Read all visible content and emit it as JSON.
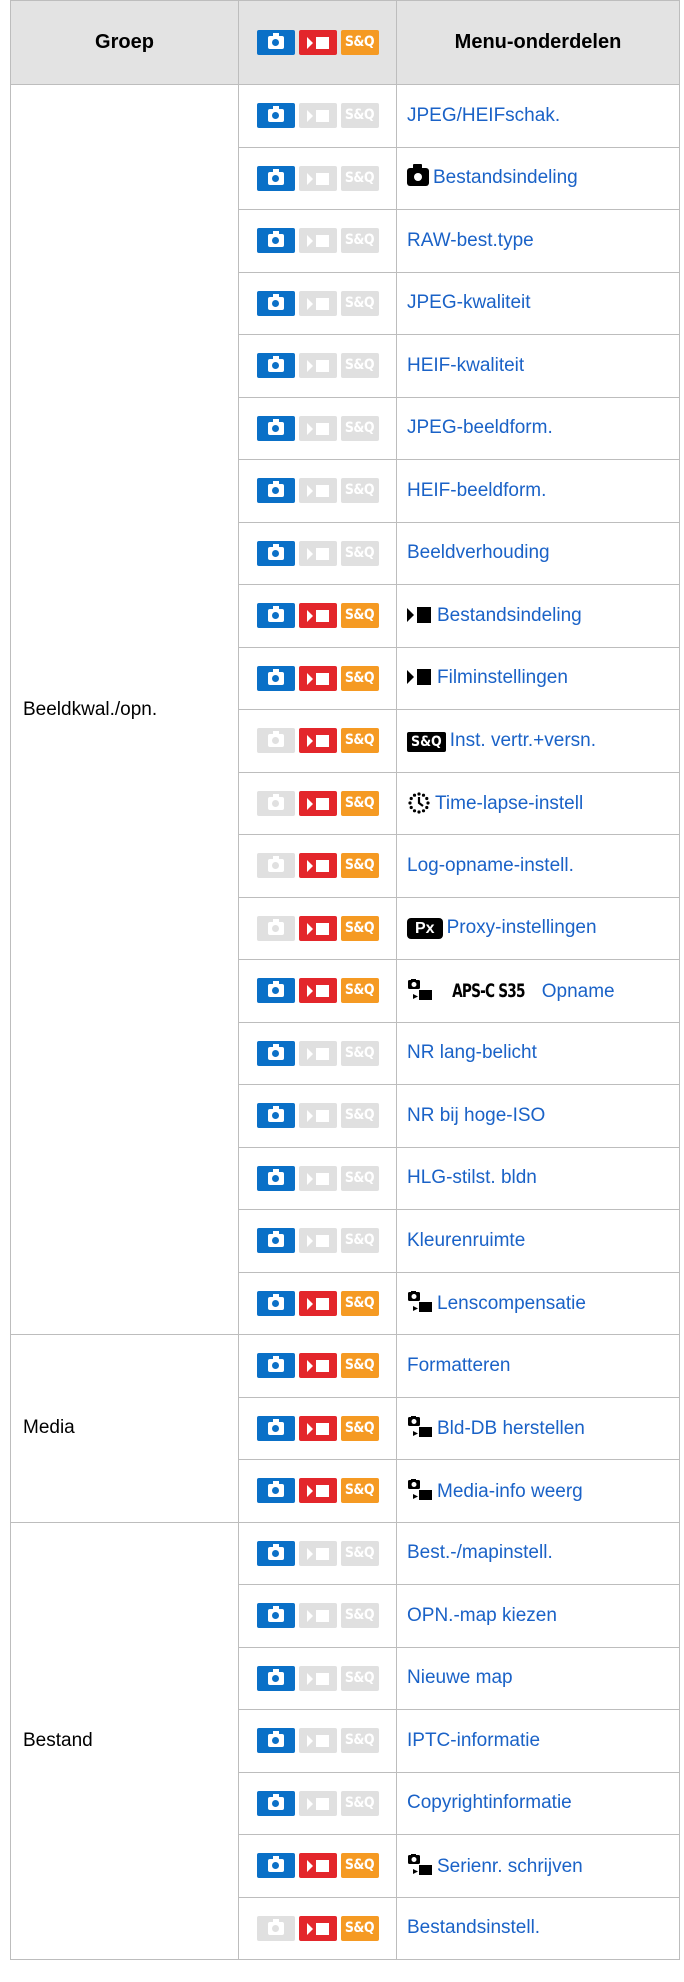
{
  "header": {
    "group": "Groep",
    "menu": "Menu-onderdelen"
  },
  "mode_icons": {
    "photo": "camera-photo-icon",
    "movie": "movie-icon",
    "sq": "S&Q",
    "colors": {
      "photo": "#0a70c7",
      "movie": "#e3262b",
      "sq": "#f59a23",
      "off": "#e0e0e0",
      "link": "#1a62c7"
    }
  },
  "header_modes": {
    "photo": true,
    "movie": true,
    "sq": true
  },
  "prefix_icons": {
    "aps_label": "APS-C S35",
    "px_label": "Px",
    "sq_label": "S&Q"
  },
  "groups": [
    {
      "name": "Beeldkwal./opn.",
      "rows": [
        {
          "label": "JPEG/HEIFschak.",
          "photo": true,
          "movie": false,
          "sq": false,
          "prefix": ""
        },
        {
          "label": "Bestandsindeling",
          "photo": true,
          "movie": false,
          "sq": false,
          "prefix": "camera"
        },
        {
          "label": "RAW-best.type",
          "photo": true,
          "movie": false,
          "sq": false,
          "prefix": ""
        },
        {
          "label": "JPEG-kwaliteit",
          "photo": true,
          "movie": false,
          "sq": false,
          "prefix": ""
        },
        {
          "label": "HEIF-kwaliteit",
          "photo": true,
          "movie": false,
          "sq": false,
          "prefix": ""
        },
        {
          "label": "JPEG-beeldform.",
          "photo": true,
          "movie": false,
          "sq": false,
          "prefix": ""
        },
        {
          "label": "HEIF-beeldform.",
          "photo": true,
          "movie": false,
          "sq": false,
          "prefix": ""
        },
        {
          "label": "Beeldverhouding",
          "photo": true,
          "movie": false,
          "sq": false,
          "prefix": ""
        },
        {
          "label": "Bestandsindeling",
          "photo": true,
          "movie": true,
          "sq": true,
          "prefix": "movie"
        },
        {
          "label": "Filminstellingen",
          "photo": true,
          "movie": true,
          "sq": true,
          "prefix": "movie"
        },
        {
          "label": "Inst. vertr.+versn.",
          "photo": false,
          "movie": true,
          "sq": true,
          "prefix": "sq"
        },
        {
          "label": "Time-lapse-instell",
          "photo": false,
          "movie": true,
          "sq": true,
          "prefix": "timelapse"
        },
        {
          "label": "Log-opname-instell.",
          "photo": false,
          "movie": true,
          "sq": true,
          "prefix": ""
        },
        {
          "label": "Proxy-instellingen",
          "photo": false,
          "movie": true,
          "sq": true,
          "prefix": "px"
        },
        {
          "label": "Opname",
          "photo": true,
          "movie": true,
          "sq": true,
          "prefix": "select-aps"
        },
        {
          "label": "NR lang-belicht",
          "photo": true,
          "movie": false,
          "sq": false,
          "prefix": ""
        },
        {
          "label": "NR bij hoge-ISO",
          "photo": true,
          "movie": false,
          "sq": false,
          "prefix": ""
        },
        {
          "label": "HLG-stilst. bldn",
          "photo": true,
          "movie": false,
          "sq": false,
          "prefix": ""
        },
        {
          "label": "Kleurenruimte",
          "photo": true,
          "movie": false,
          "sq": false,
          "prefix": ""
        },
        {
          "label": "Lenscompensatie",
          "photo": true,
          "movie": true,
          "sq": true,
          "prefix": "select"
        }
      ]
    },
    {
      "name": "Media",
      "rows": [
        {
          "label": "Formatteren",
          "photo": true,
          "movie": true,
          "sq": true,
          "prefix": ""
        },
        {
          "label": "Bld-DB herstellen",
          "photo": true,
          "movie": true,
          "sq": true,
          "prefix": "select"
        },
        {
          "label": "Media-info weerg",
          "photo": true,
          "movie": true,
          "sq": true,
          "prefix": "select"
        }
      ]
    },
    {
      "name": "Bestand",
      "rows": [
        {
          "label": "Best.-/mapinstell.",
          "photo": true,
          "movie": false,
          "sq": false,
          "prefix": ""
        },
        {
          "label": "OPN.-map kiezen",
          "photo": true,
          "movie": false,
          "sq": false,
          "prefix": ""
        },
        {
          "label": "Nieuwe map",
          "photo": true,
          "movie": false,
          "sq": false,
          "prefix": ""
        },
        {
          "label": "IPTC-informatie",
          "photo": true,
          "movie": false,
          "sq": false,
          "prefix": ""
        },
        {
          "label": "Copyrightinformatie",
          "photo": true,
          "movie": false,
          "sq": false,
          "prefix": ""
        },
        {
          "label": "Serienr. schrijven",
          "photo": true,
          "movie": true,
          "sq": true,
          "prefix": "select"
        },
        {
          "label": "Bestandsinstell.",
          "photo": false,
          "movie": true,
          "sq": true,
          "prefix": ""
        }
      ]
    }
  ]
}
